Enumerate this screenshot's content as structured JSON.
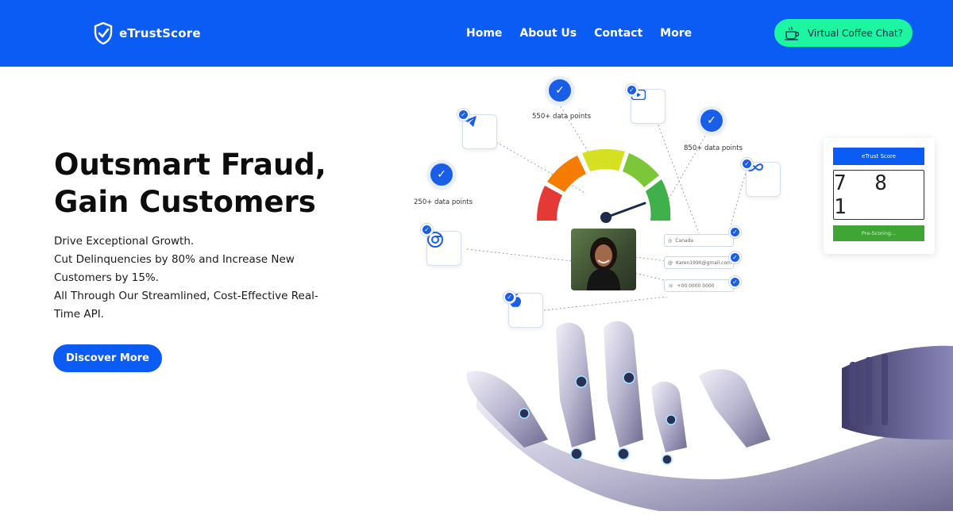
{
  "brand": {
    "name": "eTrustScore",
    "accent": "#0a5cf5",
    "cta_color": "#1df5a3"
  },
  "nav": {
    "links": [
      "Home",
      "About Us",
      "Contact",
      "More"
    ],
    "cta_label": "Virtual Coffee Chat?",
    "cta_icon": "coffee-cup-icon"
  },
  "hero": {
    "title_line1": "Outsmart Fraud,",
    "title_line2": "Gain Customers",
    "desc_lines": [
      "Drive Exceptional Growth.",
      "Cut Delinquencies by 80% and Increase New",
      "Customers by 15%.",
      "All Through Our Streamlined, Cost-Effective Real-",
      "Time API."
    ],
    "button_label": "Discover More"
  },
  "illustration": {
    "data_points": [
      "550+ data points",
      "850+ data points",
      "250+ data points"
    ],
    "source_icons": [
      "telegram-icon",
      "youtube-icon",
      "meta-icon",
      "chrome-icon",
      "apple-icon"
    ],
    "fields": [
      "Canada",
      "Karen1990@gmail.com",
      "+00 0000 0000"
    ],
    "gauge_colors": [
      "#e53935",
      "#f57c00",
      "#d4e021",
      "#7cc63a",
      "#3fb04a"
    ],
    "score": {
      "title": "eTrust Score",
      "value": "7 8 1",
      "button_label": "Pre-Scoring..."
    }
  }
}
